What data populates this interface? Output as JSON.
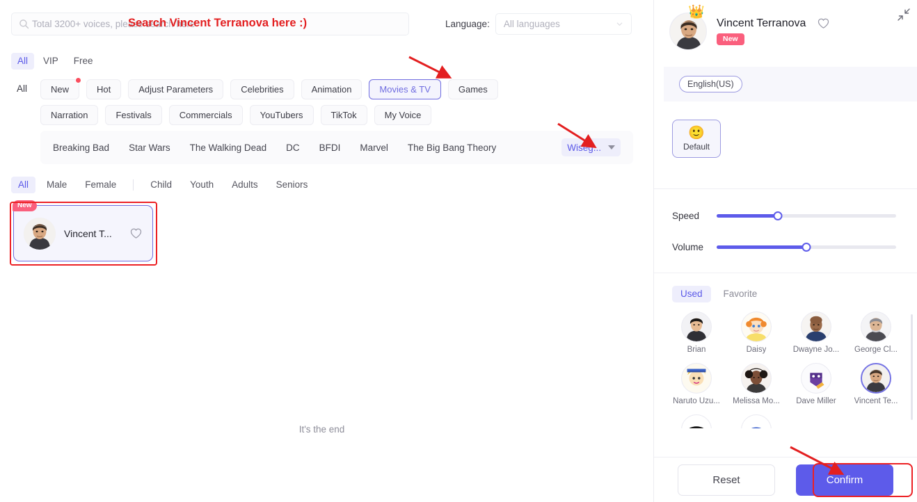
{
  "search": {
    "placeholder": "Total 3200+ voices, please search here",
    "value": "",
    "icon": "search-icon"
  },
  "language_filter": {
    "label": "Language:",
    "value": "All languages",
    "icon": "chevron-down-icon"
  },
  "plan_tabs": [
    {
      "label": "All",
      "active": true
    },
    {
      "label": "VIP",
      "active": false
    },
    {
      "label": "Free",
      "active": false
    }
  ],
  "categories": {
    "all_label": "All",
    "row1": [
      {
        "label": "New",
        "selected": false,
        "dot": true
      },
      {
        "label": "Hot",
        "selected": false,
        "dot": false
      },
      {
        "label": "Adjust Parameters",
        "selected": false,
        "dot": false
      },
      {
        "label": "Celebrities",
        "selected": false,
        "dot": false
      },
      {
        "label": "Animation",
        "selected": false,
        "dot": false
      },
      {
        "label": "Movies & TV",
        "selected": true,
        "dot": false
      },
      {
        "label": "Games",
        "selected": false,
        "dot": false
      }
    ],
    "row2": [
      {
        "label": "Narration",
        "selected": false,
        "dot": false
      },
      {
        "label": "Festivals",
        "selected": false,
        "dot": false
      },
      {
        "label": "Commercials",
        "selected": false,
        "dot": false
      },
      {
        "label": "YouTubers",
        "selected": false,
        "dot": false
      },
      {
        "label": "TikTok",
        "selected": false,
        "dot": false
      },
      {
        "label": "My Voice",
        "selected": false,
        "dot": false
      }
    ]
  },
  "subtags": {
    "items": [
      "Breaking Bad",
      "Star Wars",
      "The Walking Dead",
      "DC",
      "BFDI",
      "Marvel",
      "The Big Bang Theory"
    ],
    "more_label": "Wiseg...",
    "more_icon": "caret-down-icon"
  },
  "demographic_filters": [
    {
      "label": "All",
      "active": true
    },
    {
      "label": "Male",
      "active": false
    },
    {
      "label": "Female",
      "active": false
    },
    {
      "label": "Child",
      "active": false
    },
    {
      "label": "Youth",
      "active": false
    },
    {
      "label": "Adults",
      "active": false
    },
    {
      "label": "Seniors",
      "active": false
    }
  ],
  "voice_results": {
    "cards": [
      {
        "name": "Vincent T...",
        "badge": "New",
        "selected": true,
        "favorite_icon": "heart-icon"
      }
    ],
    "end_text": "It's the end"
  },
  "detail_panel": {
    "collapse_icon": "collapse-icon",
    "voice_name": "Vincent Terranova",
    "badge": "New",
    "favorite_icon": "heart-icon",
    "crown_icon": "crown-icon",
    "language_chip": "English(US)",
    "emotion": {
      "label": "Default",
      "emoji": "🙂",
      "selected": true
    },
    "sliders": [
      {
        "label": "Speed",
        "percent": 34
      },
      {
        "label": "Volume",
        "percent": 50
      }
    ],
    "library_tabs": [
      {
        "label": "Used",
        "active": true
      },
      {
        "label": "Favorite",
        "active": false
      }
    ],
    "library_avatars": [
      {
        "name": "Brian",
        "selected": false
      },
      {
        "name": "Daisy",
        "selected": false
      },
      {
        "name": "Dwayne Jo...",
        "selected": false
      },
      {
        "name": "George Cl...",
        "selected": false
      },
      {
        "name": "Naruto Uzu...",
        "selected": false
      },
      {
        "name": "Melissa Mo...",
        "selected": false
      },
      {
        "name": "Dave Miller",
        "selected": false
      },
      {
        "name": "Vincent Te...",
        "selected": true
      }
    ],
    "buttons": {
      "reset": "Reset",
      "confirm": "Confirm"
    }
  },
  "annotations": {
    "search_note": "Search Vincent Terranova here :)",
    "color": "#e31f20"
  }
}
